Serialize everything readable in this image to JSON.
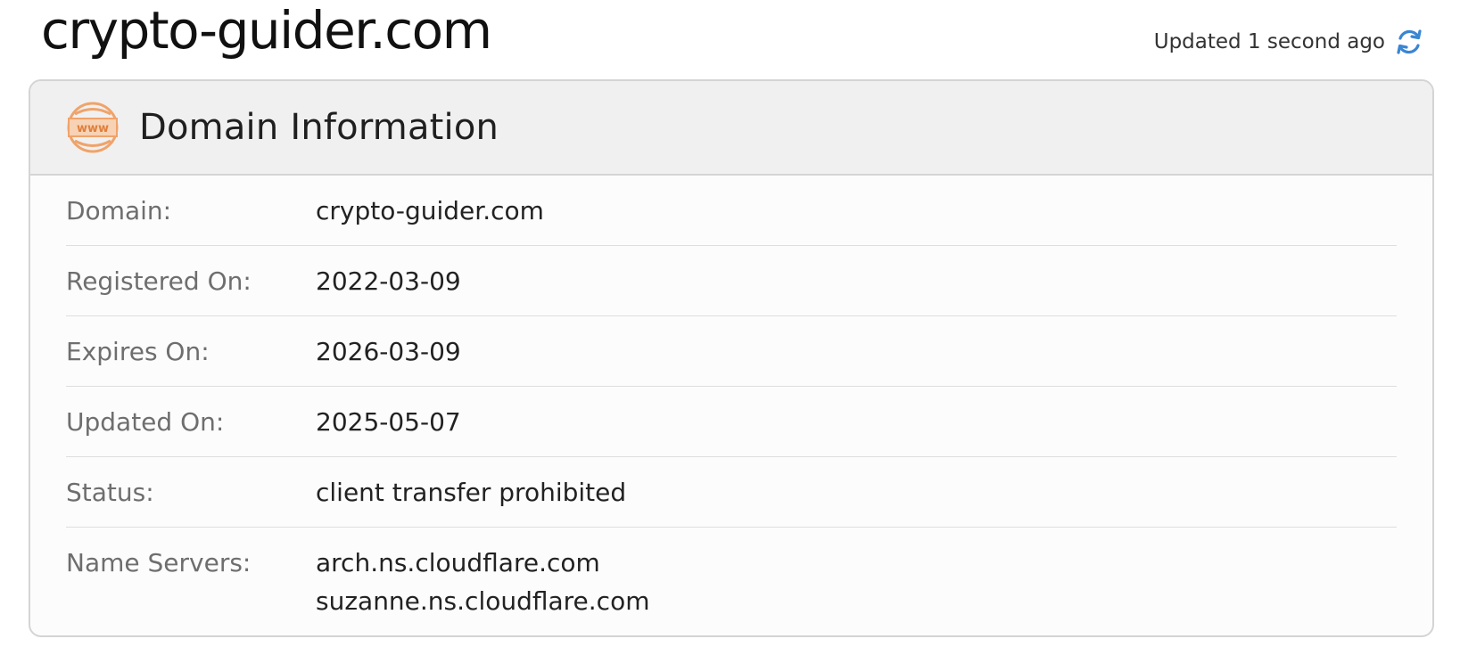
{
  "page": {
    "title": "crypto-guider.com",
    "updated_text": "Updated 1 second ago"
  },
  "colors": {
    "accent_icon": "#f0a36a",
    "refresh": "#3a86d4"
  },
  "icons": {
    "header": "www-globe-icon",
    "refresh": "refresh-icon"
  },
  "card": {
    "title": "Domain Information",
    "rows": [
      {
        "label": "Domain:",
        "value": "crypto-guider.com"
      },
      {
        "label": "Registered On:",
        "value": "2022-03-09"
      },
      {
        "label": "Expires On:",
        "value": "2026-03-09"
      },
      {
        "label": "Updated On:",
        "value": "2025-05-07"
      },
      {
        "label": "Status:",
        "value": "client transfer prohibited"
      },
      {
        "label": "Name Servers:",
        "values": [
          "arch.ns.cloudflare.com",
          "suzanne.ns.cloudflare.com"
        ]
      }
    ]
  }
}
